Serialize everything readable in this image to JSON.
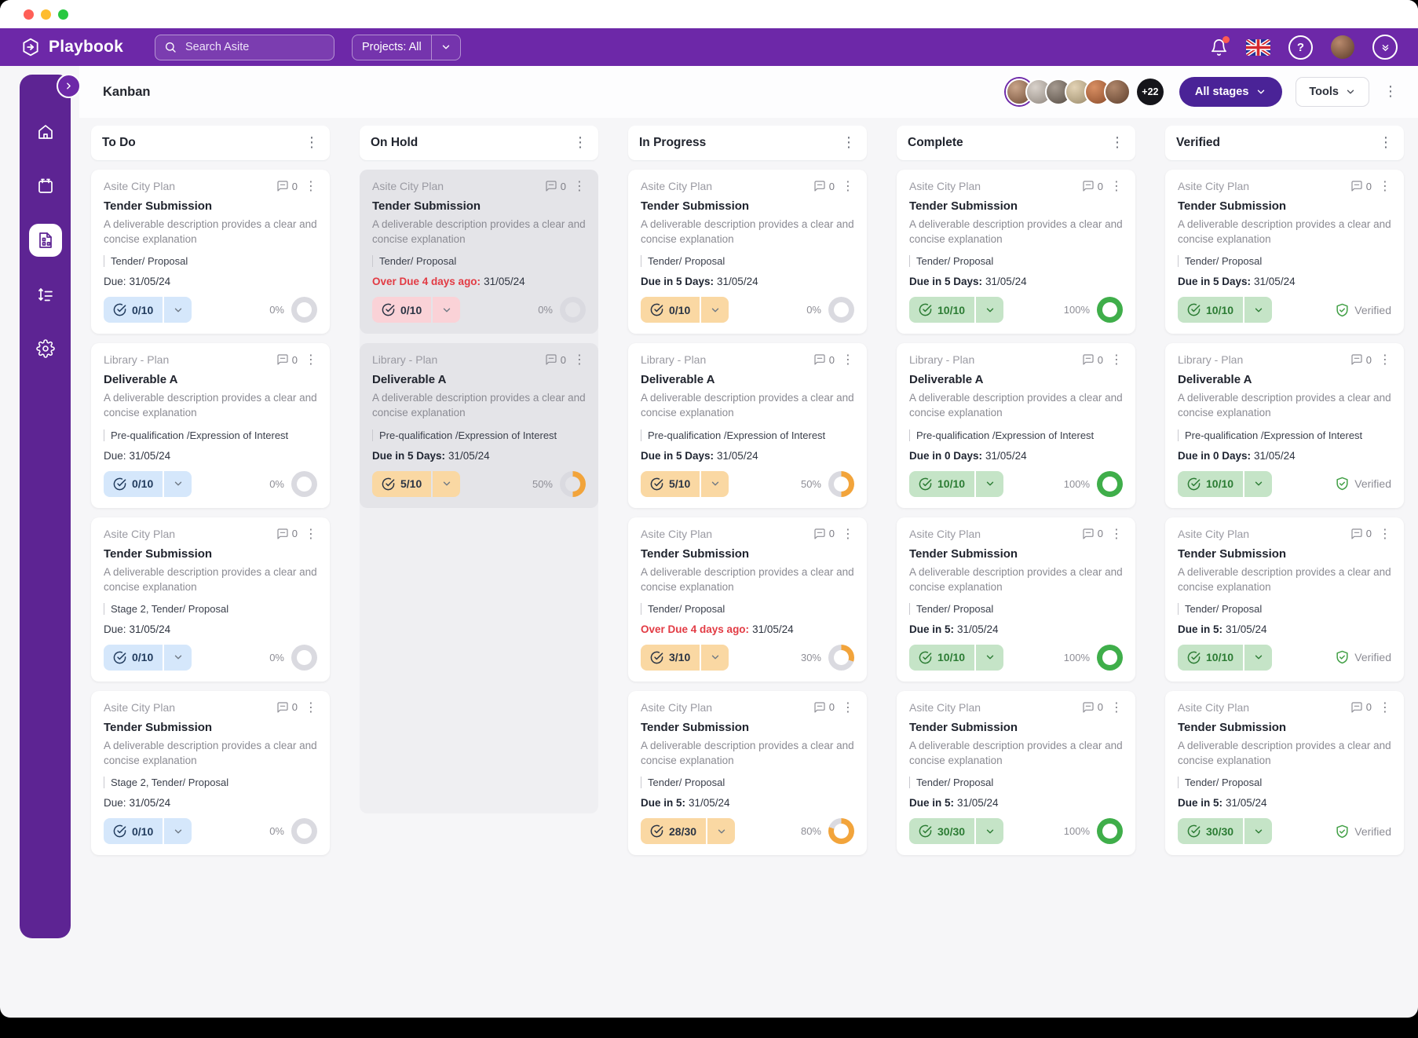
{
  "topbar": {
    "app_name": "Playbook",
    "search_placeholder": "Search Asite",
    "projects_filter": "Projects: All"
  },
  "header": {
    "title": "Kanban",
    "avatar_overflow": "+22",
    "stage_filter_label": "All stages",
    "tools_label": "Tools"
  },
  "sidebar": {
    "items": [
      "home",
      "calendar",
      "kanban-board",
      "task-list",
      "settings"
    ],
    "active": "kanban-board"
  },
  "colors": {
    "brand_purple": "#6D28A8",
    "sidebar_purple": "#5D2493",
    "stage_button_purple": "#4A2397",
    "overdue_red": "#E23B44",
    "ring_gray": "#DADAE0",
    "ring_orange": "#F2A43B",
    "ring_green": "#3FAE4A",
    "verified_green": "#43A047",
    "chip_blue_bg": "#D5E7FB",
    "chip_pink_bg": "#FAD2D7",
    "chip_orange_bg": "#FAD8A3",
    "chip_green_bg": "#C5E4C7"
  },
  "columns": [
    {
      "title": "To Do",
      "cards": [
        {
          "project": "Asite City Plan",
          "comments": "0",
          "title": "Tender Submission",
          "description": "A deliverable description provides a clear and concise explanation",
          "tag": "Tender/ Proposal",
          "due": {
            "label": "Due:",
            "value": "31/05/24",
            "style": "plain"
          },
          "chip": {
            "count": "0/10",
            "tone": "blue"
          },
          "status": {
            "type": "ring",
            "percent": 0,
            "label": "0%",
            "tone": "gray"
          }
        },
        {
          "project": "Library - Plan",
          "comments": "0",
          "title": "Deliverable A",
          "description": "A deliverable description provides a clear and concise explanation",
          "tag": "Pre-qualification /Expression of Interest",
          "due": {
            "label": "Due:",
            "value": "31/05/24",
            "style": "plain"
          },
          "chip": {
            "count": "0/10",
            "tone": "blue"
          },
          "status": {
            "type": "ring",
            "percent": 0,
            "label": "0%",
            "tone": "gray"
          }
        },
        {
          "project": "Asite City Plan",
          "comments": "0",
          "title": "Tender Submission",
          "description": "A deliverable description provides a clear and concise explanation",
          "tag": "Stage 2, Tender/ Proposal",
          "due": {
            "label": "Due:",
            "value": "31/05/24",
            "style": "plain"
          },
          "chip": {
            "count": "0/10",
            "tone": "blue"
          },
          "status": {
            "type": "ring",
            "percent": 0,
            "label": "0%",
            "tone": "gray"
          }
        },
        {
          "project": "Asite City Plan",
          "comments": "0",
          "title": "Tender Submission",
          "description": "A deliverable description provides a clear and concise explanation",
          "tag": "Stage 2, Tender/ Proposal",
          "due": {
            "label": "Due:",
            "value": "31/05/24",
            "style": "plain"
          },
          "chip": {
            "count": "0/10",
            "tone": "blue"
          },
          "status": {
            "type": "ring",
            "percent": 0,
            "label": "0%",
            "tone": "gray"
          }
        }
      ]
    },
    {
      "title": "On Hold",
      "muted": true,
      "cards": [
        {
          "project": "Asite City Plan",
          "comments": "0",
          "title": "Tender Submission",
          "description": "A deliverable description provides a clear and concise explanation",
          "tag": "Tender/ Proposal",
          "due": {
            "label": "Over Due 4 days ago:",
            "value": "31/05/24",
            "style": "overdue"
          },
          "chip": {
            "count": "0/10",
            "tone": "pink"
          },
          "status": {
            "type": "ring",
            "percent": 0,
            "label": "0%",
            "tone": "gray"
          }
        },
        {
          "project": "Library - Plan",
          "comments": "0",
          "title": "Deliverable A",
          "description": "A deliverable description provides a clear and concise explanation",
          "tag": "Pre-qualification /Expression of Interest",
          "due": {
            "label": "Due in 5 Days:",
            "value": "31/05/24",
            "style": "bold"
          },
          "chip": {
            "count": "5/10",
            "tone": "orange"
          },
          "status": {
            "type": "ring",
            "percent": 50,
            "label": "50%",
            "tone": "orange"
          }
        }
      ]
    },
    {
      "title": "In Progress",
      "cards": [
        {
          "project": "Asite City Plan",
          "comments": "0",
          "title": "Tender Submission",
          "description": "A deliverable description provides a clear and concise explanation",
          "tag": "Tender/ Proposal",
          "due": {
            "label": "Due in 5 Days:",
            "value": "31/05/24",
            "style": "bold"
          },
          "chip": {
            "count": "0/10",
            "tone": "orange"
          },
          "status": {
            "type": "ring",
            "percent": 0,
            "label": "0%",
            "tone": "gray"
          }
        },
        {
          "project": "Library - Plan",
          "comments": "0",
          "title": "Deliverable A",
          "description": "A deliverable description provides a clear and concise explanation",
          "tag": "Pre-qualification /Expression of Interest",
          "due": {
            "label": "Due in 5 Days:",
            "value": "31/05/24",
            "style": "bold"
          },
          "chip": {
            "count": "5/10",
            "tone": "orange"
          },
          "status": {
            "type": "ring",
            "percent": 50,
            "label": "50%",
            "tone": "orange"
          }
        },
        {
          "project": "Asite City Plan",
          "comments": "0",
          "title": "Tender Submission",
          "description": "A deliverable description provides a clear and concise explanation",
          "tag": "Tender/ Proposal",
          "due": {
            "label": "Over Due 4 days ago:",
            "value": "31/05/24",
            "style": "overdue"
          },
          "chip": {
            "count": "3/10",
            "tone": "orange"
          },
          "status": {
            "type": "ring",
            "percent": 30,
            "label": "30%",
            "tone": "orange"
          }
        },
        {
          "project": "Asite City Plan",
          "comments": "0",
          "title": "Tender Submission",
          "description": "A deliverable description provides a clear and concise explanation",
          "tag": "Tender/ Proposal",
          "due": {
            "label": "Due in 5:",
            "value": "31/05/24",
            "style": "bold"
          },
          "chip": {
            "count": "28/30",
            "tone": "orange"
          },
          "status": {
            "type": "ring",
            "percent": 80,
            "label": "80%",
            "tone": "orange"
          }
        }
      ]
    },
    {
      "title": "Complete",
      "cards": [
        {
          "project": "Asite City Plan",
          "comments": "0",
          "title": "Tender Submission",
          "description": "A deliverable description provides a clear and concise explanation",
          "tag": "Tender/ Proposal",
          "due": {
            "label": "Due in 5 Days:",
            "value": "31/05/24",
            "style": "bold"
          },
          "chip": {
            "count": "10/10",
            "tone": "green"
          },
          "status": {
            "type": "ring",
            "percent": 100,
            "label": "100%",
            "tone": "green"
          }
        },
        {
          "project": "Library - Plan",
          "comments": "0",
          "title": "Deliverable A",
          "description": "A deliverable description provides a clear and concise explanation",
          "tag": "Pre-qualification /Expression of Interest",
          "due": {
            "label": "Due in 0 Days:",
            "value": "31/05/24",
            "style": "bold"
          },
          "chip": {
            "count": "10/10",
            "tone": "green"
          },
          "status": {
            "type": "ring",
            "percent": 100,
            "label": "100%",
            "tone": "green"
          }
        },
        {
          "project": "Asite City Plan",
          "comments": "0",
          "title": "Tender Submission",
          "description": "A deliverable description provides a clear and concise explanation",
          "tag": "Tender/ Proposal",
          "due": {
            "label": "Due in 5:",
            "value": "31/05/24",
            "style": "bold"
          },
          "chip": {
            "count": "10/10",
            "tone": "green"
          },
          "status": {
            "type": "ring",
            "percent": 100,
            "label": "100%",
            "tone": "green"
          }
        },
        {
          "project": "Asite City Plan",
          "comments": "0",
          "title": "Tender Submission",
          "description": "A deliverable description provides a clear and concise explanation",
          "tag": "Tender/ Proposal",
          "due": {
            "label": "Due in 5:",
            "value": "31/05/24",
            "style": "bold"
          },
          "chip": {
            "count": "30/30",
            "tone": "green"
          },
          "status": {
            "type": "ring",
            "percent": 100,
            "label": "100%",
            "tone": "green"
          }
        }
      ]
    },
    {
      "title": "Verified",
      "cards": [
        {
          "project": "Asite City Plan",
          "comments": "0",
          "title": "Tender Submission",
          "description": "A deliverable description provides a clear and concise explanation",
          "tag": "Tender/ Proposal",
          "due": {
            "label": "Due in 5 Days:",
            "value": "31/05/24",
            "style": "bold"
          },
          "chip": {
            "count": "10/10",
            "tone": "green"
          },
          "status": {
            "type": "verified",
            "label": "Verified"
          }
        },
        {
          "project": "Library - Plan",
          "comments": "0",
          "title": "Deliverable A",
          "description": "A deliverable description provides a clear and concise explanation",
          "tag": "Pre-qualification /Expression of Interest",
          "due": {
            "label": "Due in 0 Days:",
            "value": "31/05/24",
            "style": "bold"
          },
          "chip": {
            "count": "10/10",
            "tone": "green"
          },
          "status": {
            "type": "verified",
            "label": "Verified"
          }
        },
        {
          "project": "Asite City Plan",
          "comments": "0",
          "title": "Tender Submission",
          "description": "A deliverable description provides a clear and concise explanation",
          "tag": "Tender/ Proposal",
          "due": {
            "label": "Due in 5:",
            "value": "31/05/24",
            "style": "bold"
          },
          "chip": {
            "count": "10/10",
            "tone": "green"
          },
          "status": {
            "type": "verified",
            "label": "Verified"
          }
        },
        {
          "project": "Asite City Plan",
          "comments": "0",
          "title": "Tender Submission",
          "description": "A deliverable description provides a clear and concise explanation",
          "tag": "Tender/ Proposal",
          "due": {
            "label": "Due in 5:",
            "value": "31/05/24",
            "style": "bold"
          },
          "chip": {
            "count": "30/30",
            "tone": "green"
          },
          "status": {
            "type": "verified",
            "label": "Verified"
          }
        }
      ]
    }
  ]
}
